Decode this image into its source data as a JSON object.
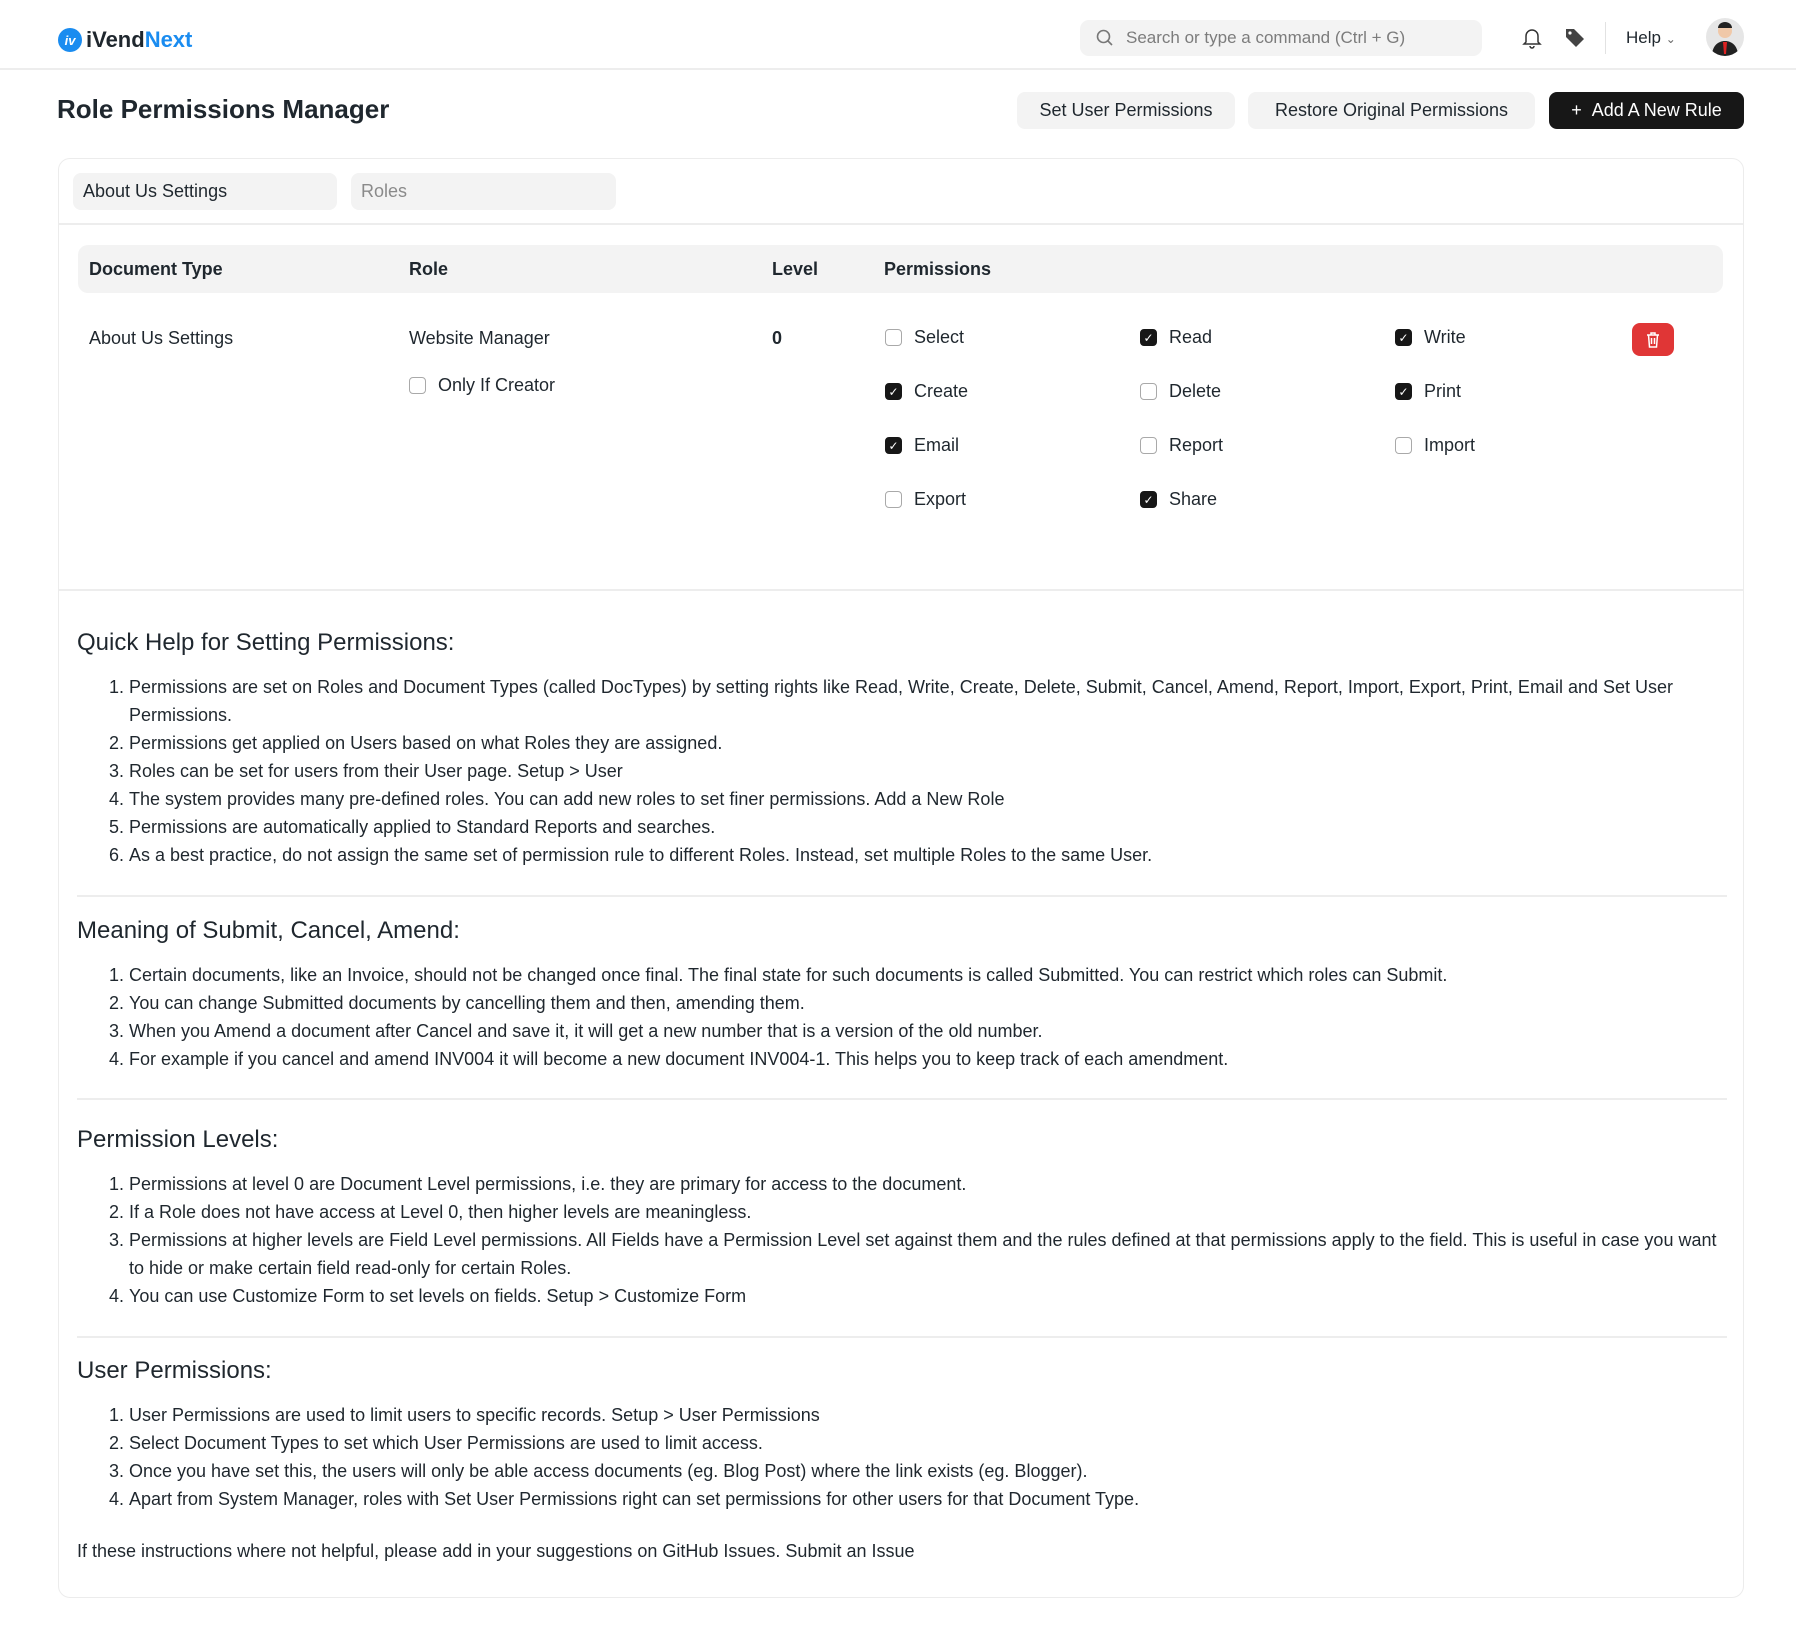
{
  "brand": {
    "name_a": "iVend",
    "name_b": "Next",
    "color": "#1a8cf0"
  },
  "search": {
    "placeholder": "Search or type a command (Ctrl + G)"
  },
  "nav": {
    "help": "Help"
  },
  "page": {
    "title": "Role Permissions Manager"
  },
  "actions": {
    "set_user_permissions": "Set User Permissions",
    "restore": "Restore Original Permissions",
    "add_rule": "Add A New Rule",
    "add_icon": "+"
  },
  "filters": {
    "document_type": "About Us Settings",
    "role_placeholder": "Roles"
  },
  "table": {
    "headers": [
      "Document Type",
      "Role",
      "Level",
      "Permissions"
    ],
    "row": {
      "document_type": "About Us Settings",
      "role": "Website Manager",
      "level": "0",
      "only_if_creator": {
        "label": "Only If Creator",
        "checked": false
      },
      "permissions": [
        {
          "label": "Select",
          "checked": false
        },
        {
          "label": "Read",
          "checked": true
        },
        {
          "label": "Write",
          "checked": true
        },
        {
          "label": "Create",
          "checked": true
        },
        {
          "label": "Delete",
          "checked": false
        },
        {
          "label": "Print",
          "checked": true
        },
        {
          "label": "Email",
          "checked": true
        },
        {
          "label": "Report",
          "checked": false
        },
        {
          "label": "Import",
          "checked": false
        },
        {
          "label": "Export",
          "checked": false
        },
        {
          "label": "Share",
          "checked": true
        }
      ]
    },
    "delete_color": "#e03636"
  },
  "help": [
    {
      "title": "Quick Help for Setting Permissions:",
      "items": [
        "Permissions are set on Roles and Document Types (called DocTypes) by setting rights like Read, Write, Create, Delete, Submit, Cancel, Amend, Report, Import, Export, Print, Email and Set User Permissions.",
        "Permissions get applied on Users based on what Roles they are assigned.",
        "Roles can be set for users from their User page. Setup > User",
        "The system provides many pre-defined roles. You can add new roles to set finer permissions. Add a New Role",
        "Permissions are automatically applied to Standard Reports and searches.",
        "As a best practice, do not assign the same set of permission rule to different Roles. Instead, set multiple Roles to the same User."
      ]
    },
    {
      "title": "Meaning of Submit, Cancel, Amend:",
      "items": [
        "Certain documents, like an Invoice, should not be changed once final. The final state for such documents is called Submitted. You can restrict which roles can Submit.",
        "You can change Submitted documents by cancelling them and then, amending them.",
        "When you Amend a document after Cancel and save it, it will get a new number that is a version of the old number.",
        "For example if you cancel and amend INV004 it will become a new document INV004-1. This helps you to keep track of each amendment."
      ]
    },
    {
      "title": "Permission Levels:",
      "items": [
        "Permissions at level 0 are Document Level permissions, i.e. they are primary for access to the document.",
        "If a Role does not have access at Level 0, then higher levels are meaningless.",
        "Permissions at higher levels are Field Level permissions. All Fields have a Permission Level set against them and the rules defined at that permissions apply to the field. This is useful in case you want to hide or make certain field read-only for certain Roles.",
        "You can use Customize Form to set levels on fields. Setup > Customize Form"
      ]
    },
    {
      "title": "User Permissions:",
      "items": [
        "User Permissions are used to limit users to specific records. Setup > User Permissions",
        "Select Document Types to set which User Permissions are used to limit access.",
        "Once you have set this, the users will only be able access documents (eg. Blog Post) where the link exists (eg. Blogger).",
        "Apart from System Manager, roles with Set User Permissions right can set permissions for other users for that Document Type."
      ]
    }
  ],
  "footer": {
    "text": "If these instructions where not helpful, please add in your suggestions on GitHub Issues.",
    "link": "Submit an Issue"
  }
}
